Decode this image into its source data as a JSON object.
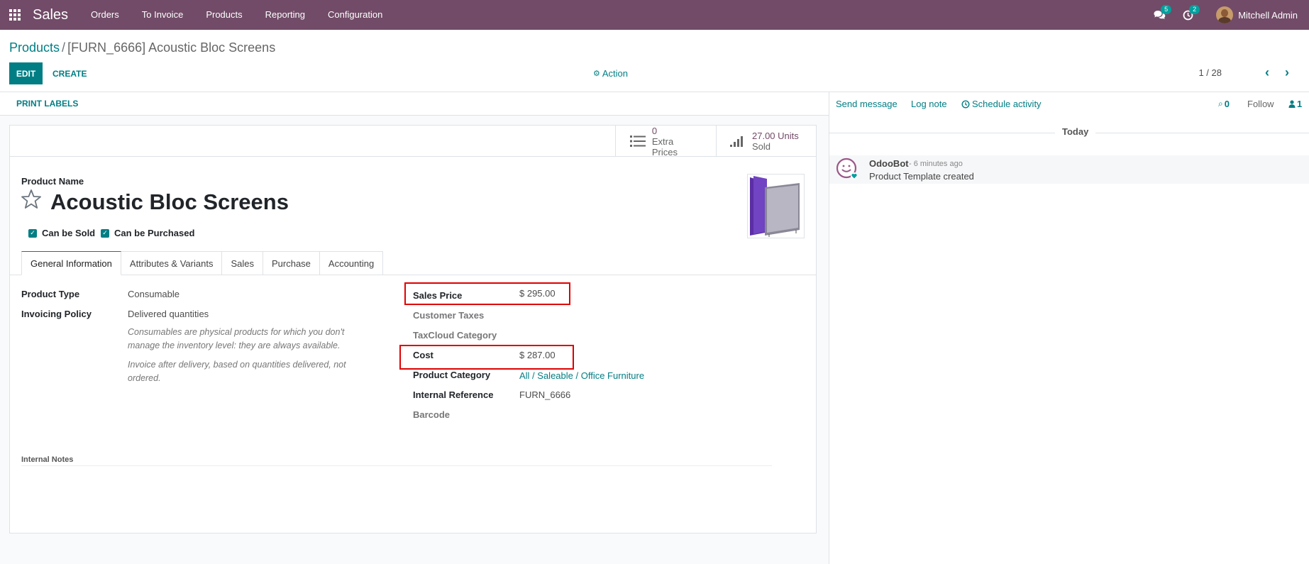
{
  "navbar": {
    "app_name": "Sales",
    "menu": [
      "Orders",
      "To Invoice",
      "Products",
      "Reporting",
      "Configuration"
    ],
    "messages_count": "5",
    "activities_count": "2",
    "user_name": "Mitchell Admin",
    "bg_color": "#714b67"
  },
  "breadcrumb": {
    "parent": "Products",
    "separator": "/",
    "current": "[FURN_6666] Acoustic Bloc Screens"
  },
  "toolbar": {
    "edit_label": "EDIT",
    "create_label": "CREATE",
    "action_label": "Action",
    "pager": "1 / 28"
  },
  "statusbar": {
    "print_labels": "PRINT LABELS"
  },
  "smart_buttons": [
    {
      "value": "0",
      "label": "Extra Prices",
      "icon": "list-icon"
    },
    {
      "value": "27.00 Units",
      "label": "Sold",
      "icon": "signal-bars-icon"
    }
  ],
  "product": {
    "name_label": "Product Name",
    "name": "Acoustic Bloc Screens",
    "can_be_sold": "Can be Sold",
    "can_be_purchased": "Can be Purchased"
  },
  "tabs": [
    "General Information",
    "Attributes & Variants",
    "Sales",
    "Purchase",
    "Accounting"
  ],
  "general_info": {
    "product_type_label": "Product Type",
    "product_type": "Consumable",
    "invoicing_policy_label": "Invoicing Policy",
    "invoicing_policy": "Delivered quantities",
    "help_consumable": "Consumables are physical products for which you don't manage the inventory level: they are always available.",
    "help_invoice": "Invoice after delivery, based on quantities delivered, not ordered.",
    "sales_price_label": "Sales Price",
    "sales_price": "$ 295.00",
    "customer_taxes_label": "Customer Taxes",
    "taxcloud_label": "TaxCloud Category",
    "cost_label": "Cost",
    "cost": "$ 287.00",
    "category_label": "Product Category",
    "category": "All / Saleable / Office Furniture",
    "internal_ref_label": "Internal Reference",
    "internal_ref": "FURN_6666",
    "barcode_label": "Barcode",
    "internal_notes_label": "Internal Notes"
  },
  "chatter": {
    "send_message": "Send message",
    "log_note": "Log note",
    "schedule_activity": "Schedule activity",
    "attachments": "0",
    "follow": "Follow",
    "followers": "1",
    "date_separator": "Today",
    "messages": [
      {
        "author": "OdooBot",
        "time": "- 6 minutes ago",
        "body": "Product Template created"
      }
    ]
  },
  "colors": {
    "accent": "#017e84",
    "brand": "#714b67",
    "highlight": "#e00000"
  }
}
